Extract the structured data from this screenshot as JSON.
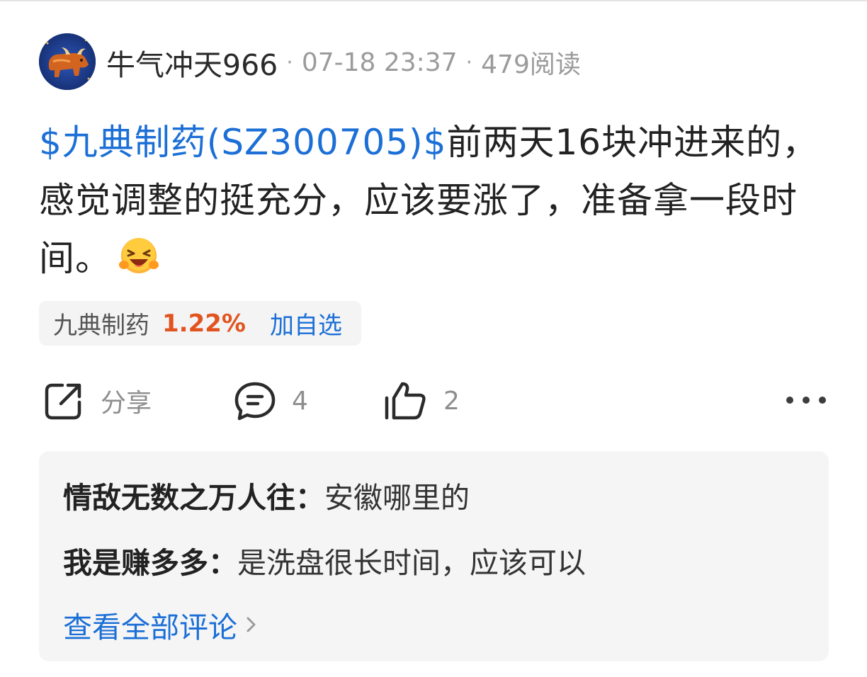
{
  "post": {
    "author": "牛气冲天966",
    "separator": "·",
    "time": "07-18 23:37",
    "reads": "479阅读",
    "stock_link": "$九典制药(SZ300705)$",
    "text": "前两天16块冲进来的，感觉调整的挺充分，应该要涨了，准备拿一段时间。",
    "emoji_icon": "laughing-face-icon"
  },
  "stock_chip": {
    "name": "九典制药",
    "change": "1.22%",
    "add_label": "加自选",
    "change_color": "#e2541f"
  },
  "actions": {
    "share_label": "分享",
    "comment_count": "4",
    "like_count": "2"
  },
  "comments": {
    "items": [
      {
        "user": "情敌无数之万人往：",
        "text": "安徽哪里的"
      },
      {
        "user": "我是赚多多：",
        "text": "是洗盘很长时间，应该可以"
      }
    ],
    "view_all": "查看全部评论"
  },
  "colors": {
    "link": "#1b6fd6",
    "muted": "#9b9b9b"
  }
}
